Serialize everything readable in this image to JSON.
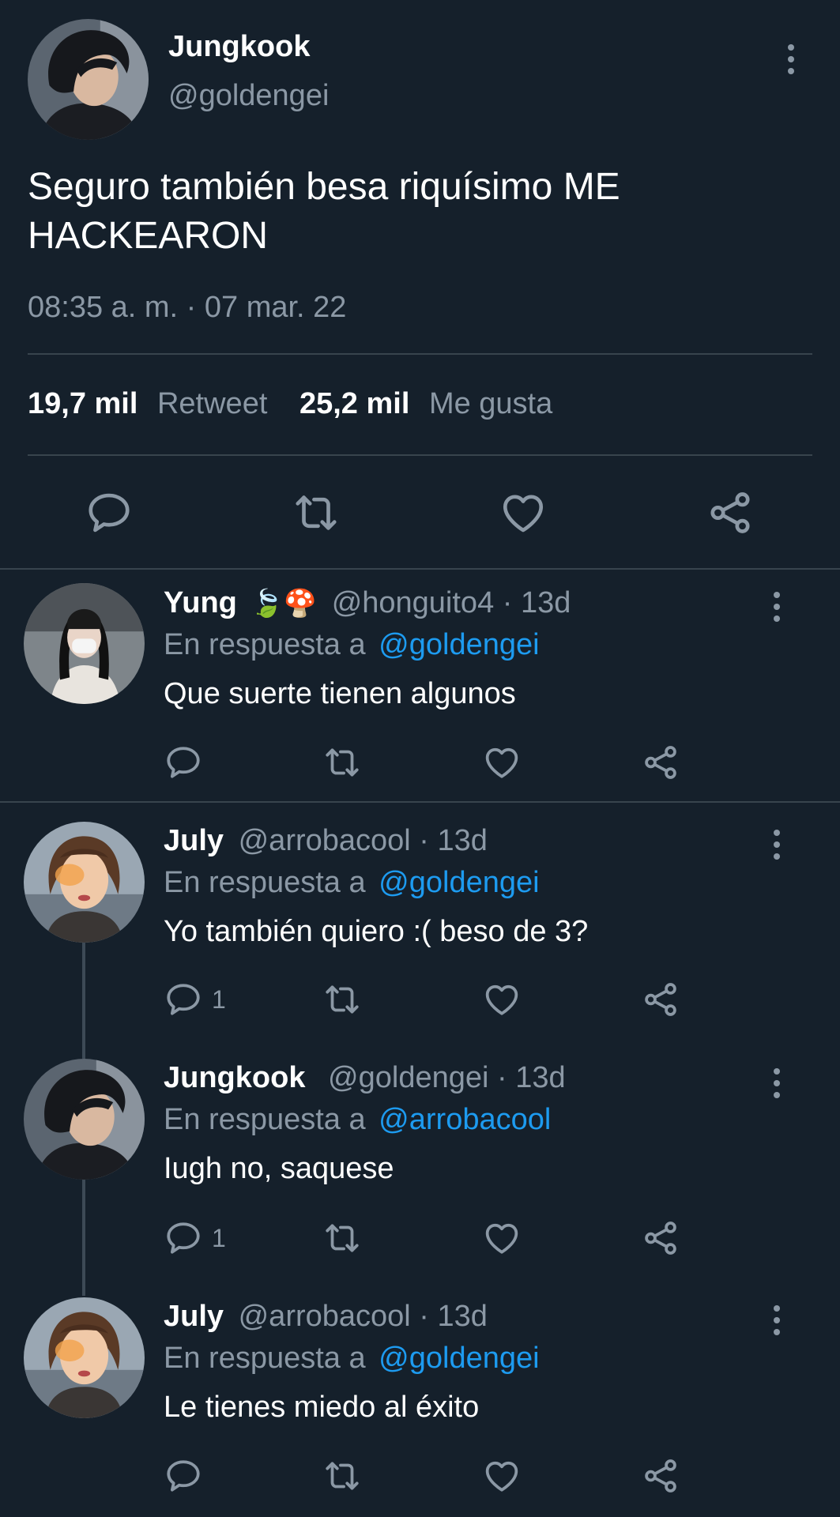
{
  "main_tweet": {
    "author_name": "Jungkook",
    "handle": "@goldengei",
    "text": "Seguro también besa riquísimo ME HACKEARON",
    "timestamp": "08:35 a. m. · 07 mar. 22",
    "retweets_count": "19,7 mil",
    "retweets_label": "Retweet",
    "likes_count": "25,2 mil",
    "likes_label": "Me gusta"
  },
  "replies": [
    {
      "name": "Yung",
      "emojis": "🍃🍄",
      "handle_time": "@honguito4 · 13d",
      "reply_prefix": "En respuesta a",
      "reply_to": "@goldengei",
      "text": "Que suerte tienen algunos",
      "reply_count": ""
    },
    {
      "name": "July",
      "handle_time": "@arrobacool · 13d",
      "reply_prefix": "En respuesta a",
      "reply_to": "@goldengei",
      "text": "Yo también quiero :( beso de 3?",
      "reply_count": "1"
    },
    {
      "name": "Jungkook",
      "handle_time": "@goldengei · 13d",
      "reply_prefix": "En respuesta a",
      "reply_to": "@arrobacool",
      "text": "Iugh no, saquese",
      "reply_count": "1"
    },
    {
      "name": "July",
      "handle_time": "@arrobacool · 13d",
      "reply_prefix": "En respuesta a",
      "reply_to": "@goldengei",
      "text": "Le tienes miedo al éxito",
      "reply_count": ""
    }
  ],
  "colors": {
    "background": "#15202b",
    "muted": "#8b98a5",
    "link": "#1d9bf0",
    "divider": "#38444d"
  },
  "icons": [
    "reply-icon",
    "retweet-icon",
    "like-icon",
    "share-icon",
    "more-options-icon"
  ]
}
